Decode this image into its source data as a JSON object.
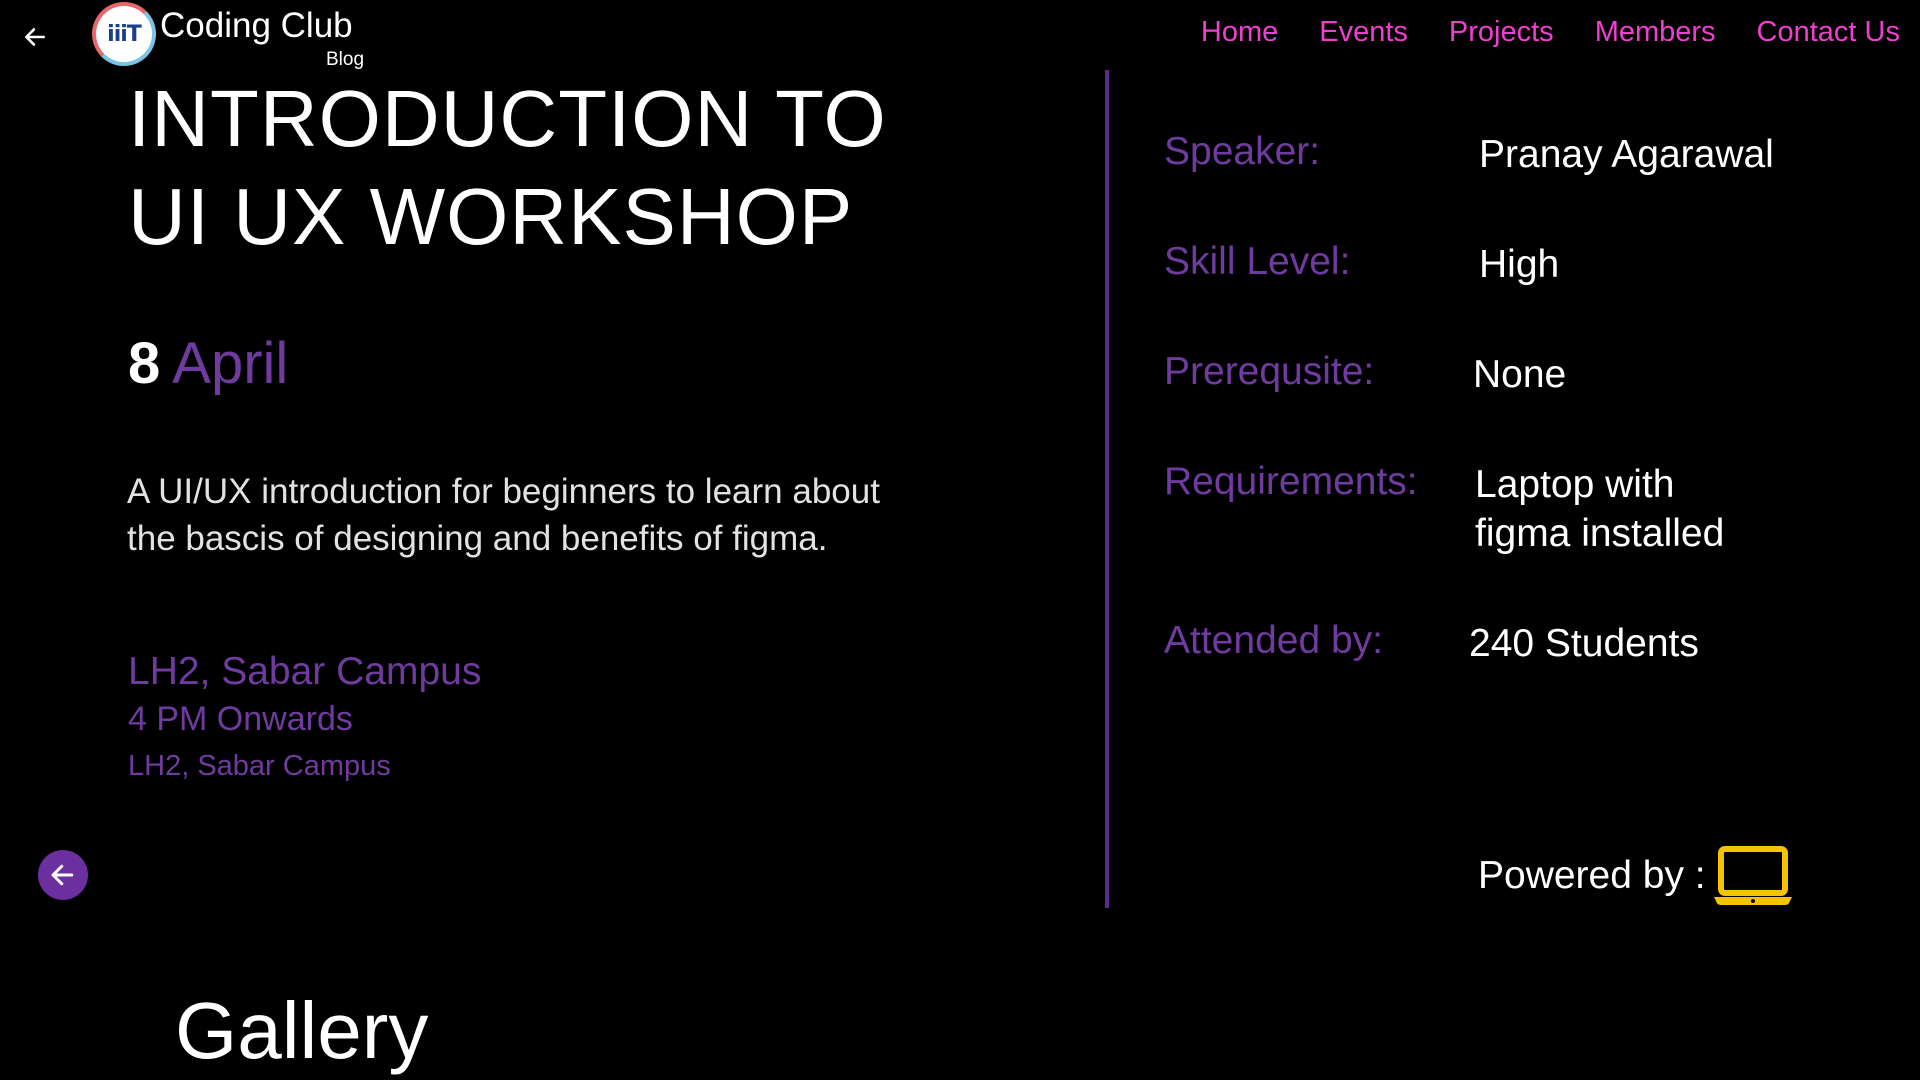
{
  "header": {
    "brand_title": "Coding Club",
    "brand_subtitle": "Blog",
    "logo_mark": "iiiT",
    "nav": [
      "Home",
      "Events",
      "Projects",
      "Members",
      "Contact Us"
    ]
  },
  "event": {
    "title_line1": "Introduction to",
    "title_line2": "UI UX Workshop",
    "date_day": "8",
    "date_month": "April",
    "description": "A UI/UX introduction for beginners to  learn about the bascis of designing and benefits of figma.",
    "venue": "LH2, Sabar Campus",
    "time": "4 PM Onwards",
    "venue_secondary": "LH2, Sabar Campus"
  },
  "details": {
    "speaker_label": "Speaker:",
    "speaker_value": "Pranay Agarawal",
    "skill_label": "Skill Level:",
    "skill_value": "High",
    "prereq_label": "Prerequsite:",
    "prereq_value": "None",
    "requirements_label": "Requirements:",
    "requirements_line1": "Laptop with",
    "requirements_line2": "figma installed",
    "attended_label": "Attended by:",
    "attended_value": "240 Students"
  },
  "powered_by": {
    "label": "Powered by :",
    "icon": "laptop-icon"
  },
  "gallery": {
    "heading": "Gallery"
  },
  "colors": {
    "background": "#000000",
    "nav": "#f03fd0",
    "accent_purple": "#6f3b9f",
    "divider": "#5d2b8a",
    "back_button": "#6b2fa0",
    "laptop_icon": "#f5c400"
  }
}
